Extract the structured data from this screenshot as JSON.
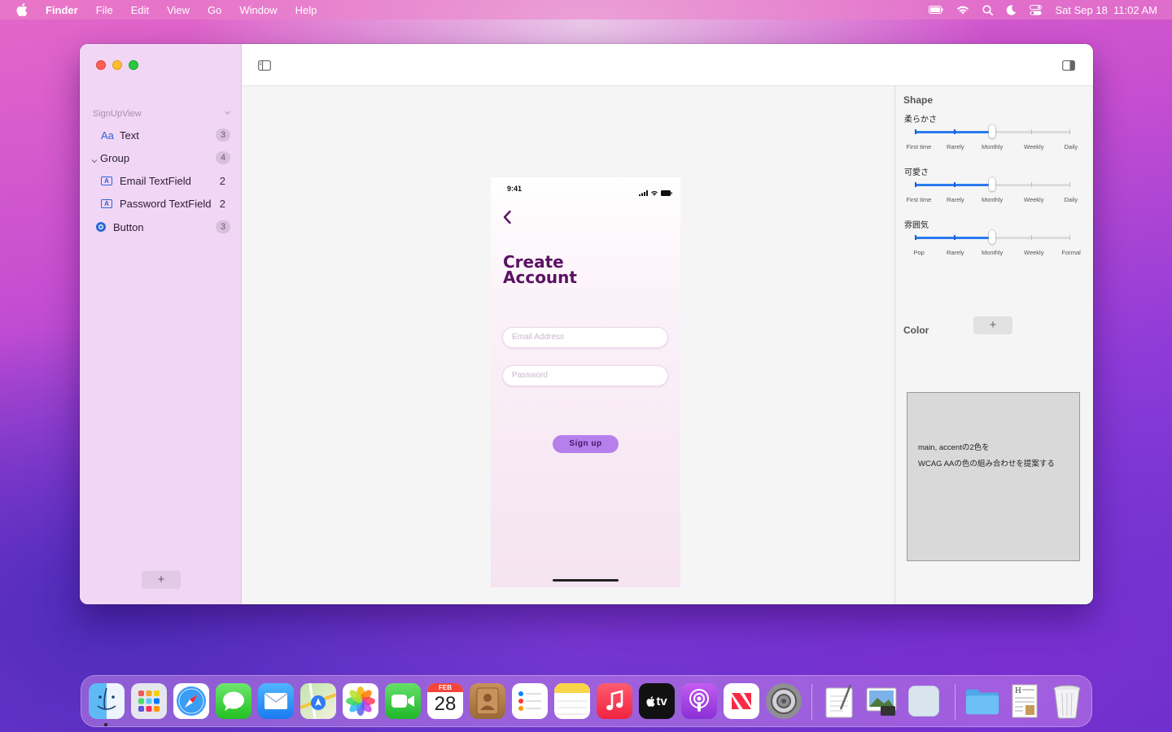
{
  "menubar": {
    "app_name": "Finder",
    "items": [
      "File",
      "Edit",
      "View",
      "Go",
      "Window",
      "Help"
    ],
    "datetime": "Sat Sep 18  11:02 AM"
  },
  "sidebar": {
    "header": "SignUpView",
    "items": [
      {
        "icon": "text-aa-icon",
        "glyph": "Aa",
        "label": "Text",
        "count": "3"
      },
      {
        "icon": "chevron-down-icon",
        "label": "Group",
        "count": "4"
      },
      {
        "icon": "textfield-icon",
        "glyph": "A",
        "label": "Email TextField",
        "count": "2"
      },
      {
        "icon": "textfield-icon",
        "glyph": "A",
        "label": "Password TextField",
        "count": "2"
      },
      {
        "icon": "button-circle-icon",
        "label": "Button",
        "count": "3"
      }
    ],
    "add_label": "+"
  },
  "preview": {
    "time": "9:41",
    "title_line1": "Create",
    "title_line2": "Account",
    "email_placeholder": "Email Address",
    "password_placeholder": "Password",
    "signup_label": "Sign up"
  },
  "inspector": {
    "shape_title": "Shape",
    "sliders": [
      {
        "label": "柔らかさ",
        "ticks": [
          "First time",
          "Rarely",
          "Monthly",
          "Weekly",
          "Daily"
        ],
        "value_index": 2
      },
      {
        "label": "可愛さ",
        "ticks": [
          "First time",
          "Rarely",
          "Monthly",
          "Weekly",
          "Daily"
        ],
        "value_index": 2
      },
      {
        "label": "雰囲気",
        "ticks": [
          "Pop",
          "Rarely",
          "Monthly",
          "Weekly",
          "Formal"
        ],
        "value_index": 2
      }
    ],
    "add_label": "+",
    "color_title": "Color",
    "note_line1": "main, accentの2色を",
    "note_line2": "WCAG AAの色の組み合わせを提案する"
  },
  "dock": {
    "calendar_month": "FEB",
    "calendar_day": "28",
    "tv_label": "tv",
    "apps": [
      "finder-icon",
      "launchpad-icon",
      "safari-icon",
      "messages-icon",
      "mail-icon",
      "maps-icon",
      "photos-icon",
      "facetime-icon",
      "calendar-icon",
      "contacts-icon",
      "reminders-icon",
      "notes-icon",
      "music-icon",
      "apple-tv-icon",
      "podcasts-icon",
      "news-icon",
      "system-preferences-icon",
      "textedit-icon",
      "preview-icon",
      "blank-app-icon",
      "folder-icon",
      "document-icon",
      "trash-icon"
    ]
  },
  "colors": {
    "sidebar_bg": "#f2d6f6",
    "title_purple": "#5b1164",
    "button_purple": "#b580ec",
    "slider_blue": "#2a7bf0"
  }
}
